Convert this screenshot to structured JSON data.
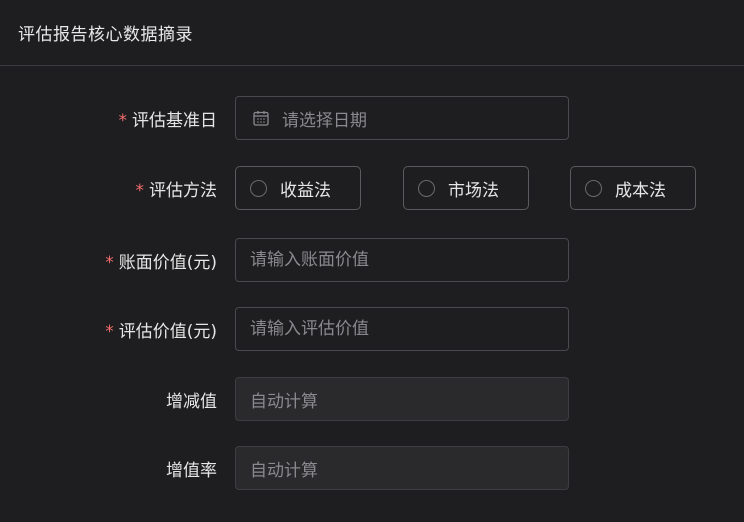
{
  "header": {
    "title": "评估报告核心数据摘录"
  },
  "form": {
    "required_mark": "*",
    "valuation_date": {
      "label": "评估基准日",
      "placeholder": "请选择日期",
      "required": true,
      "icon": "calendar-icon"
    },
    "valuation_method": {
      "label": "评估方法",
      "required": true,
      "options": [
        "收益法",
        "市场法",
        "成本法"
      ]
    },
    "book_value": {
      "label": "账面价值(元)",
      "placeholder": "请输入账面价值",
      "required": true
    },
    "appraised_value": {
      "label": "评估价值(元)",
      "placeholder": "请输入评估价值",
      "required": true
    },
    "increase_value": {
      "label": "增减值",
      "value": "自动计算",
      "required": false
    },
    "increase_rate": {
      "label": "增值率",
      "value": "自动计算",
      "required": false
    }
  },
  "colors": {
    "background": "#1e1e20",
    "required_star": "#f56c6c",
    "border": "#4a4a4e",
    "placeholder": "#8a8a8e"
  }
}
